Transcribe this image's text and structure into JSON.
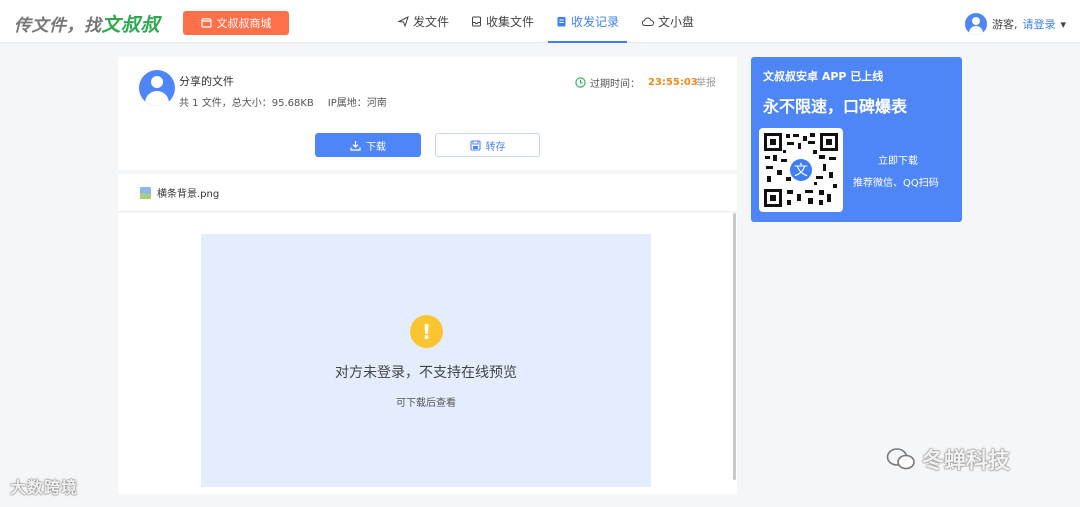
{
  "header": {
    "logo_prefix": "传文件，找",
    "logo_brand": "文叔叔",
    "shop_button": "文叔叔商城",
    "nav": [
      {
        "label": "发文件",
        "icon": "send-icon"
      },
      {
        "label": "收集文件",
        "icon": "inbox-icon"
      },
      {
        "label": "收发记录",
        "icon": "record-icon"
      },
      {
        "label": "文小盘",
        "icon": "cloud-icon"
      }
    ],
    "active_nav": "收发记录",
    "user": {
      "guest": "游客,",
      "login": "请登录",
      "dropdown": "▾"
    }
  },
  "share": {
    "title": "分享的文件",
    "file_count": "共 1 文件，总大小：95.68KB",
    "ip": "IP属地：河南",
    "expire_label": "过期时间：",
    "expire_time": "23:55:03",
    "report": "举报",
    "download_btn": "下载",
    "save_btn": "转存"
  },
  "file": {
    "name": "横条背景.png"
  },
  "preview": {
    "warning_mark": "!",
    "message": "对方未登录，不支持在线预览",
    "hint": "可下载后查看"
  },
  "promo": {
    "line1": "文叔叔安卓 APP 已上线",
    "line2": "永不限速，口碑爆表",
    "download": "立即下载",
    "scan": "推荐微信、QQ扫码",
    "qr_center": "文",
    "bg_color": "#4e86f7"
  },
  "watermarks": {
    "left": "大数跨境",
    "right": "冬蝉科技"
  },
  "colors": {
    "accent": "#3f7ff5",
    "shop": "#ff6f4a",
    "expire": "#f28a1c",
    "warning": "#fbc531"
  }
}
